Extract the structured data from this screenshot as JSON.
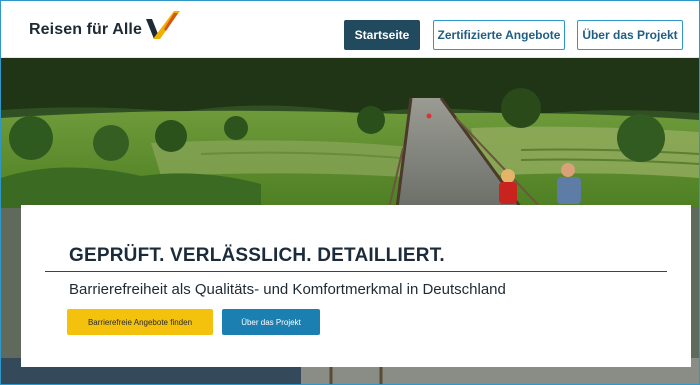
{
  "header": {
    "logo_text": "Reisen für Alle",
    "logo_mark_icon": "v-swoosh-logo-icon",
    "nav": [
      {
        "label": "Startseite",
        "active": true
      },
      {
        "label": "Zertifizierte Angebote",
        "active": false
      },
      {
        "label": "Über das Projekt",
        "active": false
      }
    ]
  },
  "hero": {
    "image_description": "cyclists-on-wooden-bridge-photo",
    "headline": "GEPRÜFT. VERLÄSSLICH. DETAILLIERT.",
    "subline": "Barrierefreiheit als Qualitäts- und Komfortmerkmal in Deutschland",
    "buttons": {
      "primary": "Barrierefreie Angebote finden",
      "secondary": "Über das Projekt"
    }
  },
  "colors": {
    "nav_active_bg": "#214a5f",
    "nav_border": "#2f97c9",
    "primary_button": "#f4c20d",
    "secondary_button": "#1c7fb1",
    "logo_orange": "#f0b000",
    "logo_dark": "#1e2a34"
  }
}
